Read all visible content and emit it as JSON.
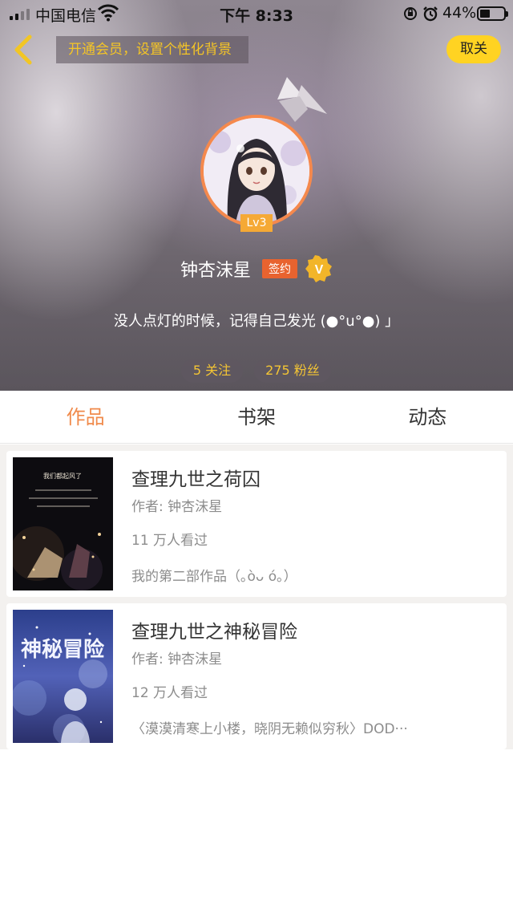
{
  "status_bar": {
    "carrier": "中国电信",
    "time": "下午 8:33",
    "battery_percent": "44%",
    "battery_level": 0.44
  },
  "header": {
    "vip_banner": "开通会员，设置个性化背景",
    "follow_button": "取关",
    "back_icon": "chevron-left-icon",
    "accent_color": "#ffd322",
    "profile": {
      "level": "Lv3",
      "username": "钟杏沫星",
      "signed_badge": "签约",
      "verified_icon": "v-badge-icon",
      "bio": "没人点灯的时候，记得自己发光 (●°u°●) 」"
    },
    "stats": {
      "following": "5 关注",
      "followers": "275 粉丝"
    }
  },
  "tabs": [
    {
      "label": "作品",
      "active": true
    },
    {
      "label": "书架",
      "active": false
    },
    {
      "label": "动态",
      "active": false
    }
  ],
  "works": [
    {
      "title": "查理九世之荷囚",
      "author": "作者: 钟杏沫星",
      "views": "11 万人看过",
      "description": "我的第二部作品（｡òᴗ ó｡）",
      "cover_text": "我们都起风了"
    },
    {
      "title": "查理九世之神秘冒险",
      "author": "作者: 钟杏沫星",
      "views": "12 万人看过",
      "description": "〈漠漠清寒上小楼，晓阴无赖似穷秋〉DOD···",
      "cover_text": "神秘冒险"
    }
  ]
}
